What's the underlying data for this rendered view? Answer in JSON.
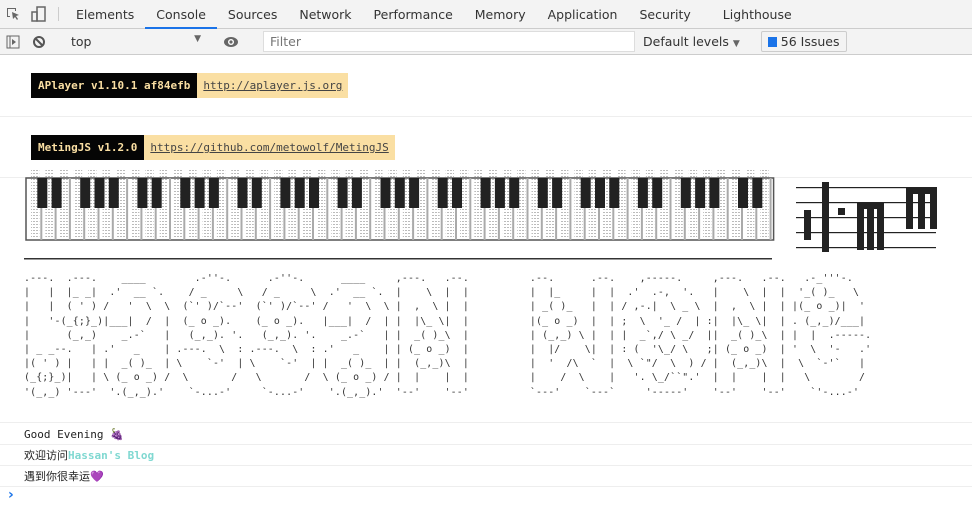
{
  "devtools": {
    "tabs": [
      "Elements",
      "Console",
      "Sources",
      "Network",
      "Performance",
      "Memory",
      "Application",
      "Security",
      "Lighthouse"
    ],
    "active_tab": "Console",
    "context": "top",
    "filter_placeholder": "Filter",
    "levels": "Default levels",
    "issues": "56 Issues",
    "colors": {
      "accent": "#1a73e8",
      "badge_dark": "#050505",
      "badge_light": "#fadfa3",
      "blog": "#7fd8d1"
    }
  },
  "console": {
    "aplayer": {
      "name": "APlayer v1.10.1 af84efb",
      "link": "http://aplayer.js.org"
    },
    "meting": {
      "name": "MetingJS v1.2.0",
      "link": "https://github.com/metowolf/MetingJS"
    },
    "art_letters": [
      [
        ".---.  .---. ",
        "|   |  |_ _| ",
        "|   |  ( ' ) ",
        "|   '-(_{;}_)",
        "|      (_,_) ",
        "| _ _--.   | ",
        "|( ' ) |   | ",
        "(_{;}_)|   | ",
        "'(_,_) '---' "
      ],
      [
        "   ____     ",
        " .'  __ `.  ",
        "/   '  \\  \\ ",
        "|___|  /  | ",
        "   _.-`   | ",
        ".'   _    | ",
        "|  _( )_  | ",
        "\\ (_ o _) / ",
        " '.(_,_).'  "
      ],
      [
        "   .-''-.   ",
        "  / _     \\ ",
        " (`' )/`--' ",
        " (_ o _).   ",
        "  (_,_). '. ",
        ".---.  \\  : ",
        "\\    `-'  | ",
        " \\       /  ",
        "  `-...-'   "
      ],
      [
        "   .-''-.   ",
        "  / _     \\ ",
        " (`' )/`--' ",
        " (_ o _).   ",
        "  (_,_). '. ",
        ".---.  \\  : ",
        "\\    `-'  | ",
        " \\       /  ",
        "  `-...-'   "
      ],
      [
        "   ____     ",
        " .'  __ `.  ",
        "/   '  \\  \\ ",
        "|___|  /  | ",
        "   _.-`   | ",
        ".'   _    | ",
        "|  _( )_  | ",
        "\\ (_ o _) / ",
        " '.(_,_).'  "
      ],
      [
        ",---.   .--.  ",
        "|    \\  |  |  ",
        "|  ,  \\ |  |  ",
        "|  |\\_ \\|  |  ",
        "|  _( )_\\  |  ",
        "| (_ o _)  |  ",
        "|  (_,_)\\  |  ",
        "|  |    |  |  ",
        "'--'    '--'  "
      ],
      [
        "        ",
        "        ",
        "        ",
        "        ",
        "        ",
        "        ",
        "        ",
        "        ",
        "        "
      ],
      [
        ".--.      .--. ",
        "|  |_     |  | ",
        "| _( )_   |  | ",
        "|(_ o _)  |  | ",
        "| (_,_) \\ |  | ",
        "|  |/    \\|  | ",
        "|  '  /\\  `  | ",
        "|    /  \\    | ",
        "`---'    `---` "
      ],
      [
        "   ,-----.     ",
        " .'  .-,  '.   ",
        "/ ,-.|  \\ _ \\  ",
        ";  \\  '_ /  | :",
        "|  _`,/ \\ _/  |",
        ": (  '\\_/ \\   ;",
        " \\ `\"/  \\  ) / ",
        "  '. \\_/``\".'  ",
        "    '-----'    "
      ],
      [
        ",---.   .--. ",
        "|    \\  |  | ",
        "|  ,  \\ |  | ",
        "|  |\\_ \\|  | ",
        "|  _( )_\\  | ",
        "| (_ o _)  | ",
        "|  (_,_)\\  | ",
        "|  |    |  | ",
        "'--'    '--' "
      ],
      [
        "  .-_'''-.   ",
        " '_( )_   \\  ",
        "|(_ o _)|  ' ",
        ". (_,_)/___| ",
        "|  |  .-----.",
        "'  \\  '-   .'",
        " \\  `-'`   | ",
        "  \\        / ",
        "   `'-...-'  "
      ]
    ],
    "messages": [
      {
        "text": "Good Evening ",
        "emoji": "🍇"
      },
      {
        "text": "欢迎访问",
        "highlight": "Hassan's Blog"
      },
      {
        "text": "遇到你很幸运",
        "emoji": "💜"
      }
    ],
    "prompt": "›"
  }
}
